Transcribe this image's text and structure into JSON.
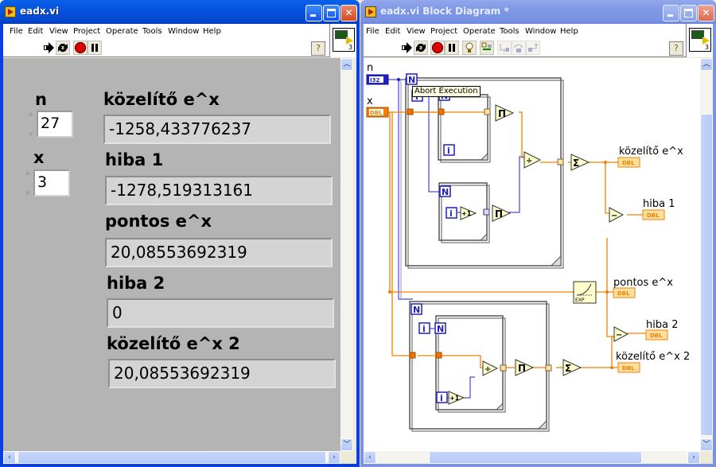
{
  "front_panel": {
    "title": "eadx.vi",
    "menu": [
      "File",
      "Edit",
      "View",
      "Project",
      "Operate",
      "Tools",
      "Window",
      "Help"
    ],
    "toolbar": [
      "run-icon",
      "run-continuously-icon",
      "abort-icon",
      "pause-icon"
    ],
    "help_label": "?",
    "vi_icon_number": "3",
    "controls": {
      "n": {
        "label": "n",
        "value": "27"
      },
      "x": {
        "label": "x",
        "value": "3"
      }
    },
    "indicators": [
      {
        "label": "közelítő e^x",
        "value": "-1258,433776237"
      },
      {
        "label": "hiba 1",
        "value": "-1278,519313161"
      },
      {
        "label": "pontos e^x",
        "value": "20,08553692319"
      },
      {
        "label": "hiba 2",
        "value": "0"
      },
      {
        "label": "közelítő e^x 2",
        "value": "20,08553692319"
      }
    ]
  },
  "block_diagram": {
    "title": "eadx.vi Block Diagram *",
    "menu": [
      "File",
      "Edit",
      "View",
      "Project",
      "Operate",
      "Tools",
      "Window",
      "Help"
    ],
    "toolbar": [
      "run-icon",
      "run-continuously-icon",
      "abort-icon",
      "pause-icon",
      "highlight-execution-icon",
      "retain-wire-values-icon",
      "step-into-icon",
      "step-over-icon",
      "step-out-icon"
    ],
    "help_label": "?",
    "vi_icon_number": "3",
    "tooltip": "Abort Execution",
    "terminals": {
      "n": {
        "label": "n",
        "type": "I32"
      },
      "x": {
        "label": "x",
        "type": "DBL"
      },
      "kozelito": {
        "label": "közelítő e^x",
        "type": "DBL"
      },
      "hiba1": {
        "label": "hiba 1",
        "type": "DBL"
      },
      "pontos": {
        "label": "pontos e^x",
        "type": "DBL"
      },
      "hiba2": {
        "label": "hiba 2",
        "type": "DBL"
      },
      "kozelito2": {
        "label": "közelítő e^x 2",
        "type": "DBL"
      }
    },
    "nodes": {
      "loop_count": "N",
      "loop_index": "i",
      "product": "Π",
      "sum": "Σ",
      "divide": "÷",
      "subtract": "−",
      "increment": "+1",
      "exp_label": "EXP"
    },
    "colors": {
      "integer_wire": "#2020c0",
      "double_wire": "#f07800",
      "node_fill": "#ffffcc"
    }
  }
}
